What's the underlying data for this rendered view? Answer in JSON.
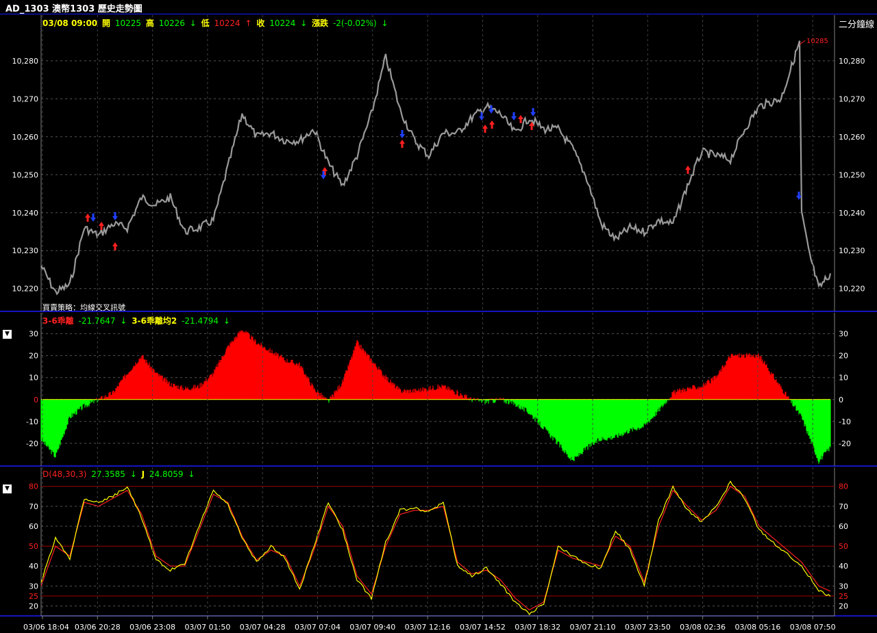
{
  "window": {
    "title": "AD_1303 澳幣1303  歷史走勢圖"
  },
  "price_panel": {
    "readout": {
      "time": "03/08 09:00",
      "open_label": "開",
      "open": "10225",
      "high_label": "高",
      "high": "10226",
      "low_label": "低",
      "low": "10224",
      "close_label": "收",
      "close": "10224",
      "change_label": "漲跌",
      "change": "-2(-0.02%)",
      "arrow_down": "↓",
      "arrow_up": "↑"
    },
    "period_label": "二分鐘線",
    "strategy_label": "買賣策略：均線交叉訊號",
    "last_high_tag": "10285",
    "y_ticks": [
      "10,280",
      "10,270",
      "10,260",
      "10,250",
      "10,240",
      "10,230",
      "10,220"
    ]
  },
  "bias_panel": {
    "readout": {
      "bias_label": "3-6乖離",
      "bias_value": "-21.7647",
      "ma_label": "3-6乖離均2",
      "ma_value": "-21.4794",
      "arrow_down": "↓"
    },
    "y_ticks": [
      "30",
      "20",
      "10",
      "0",
      "-10",
      "-20"
    ],
    "colors": {
      "positive": "#ff0000",
      "negative": "#00ff00"
    }
  },
  "kd_panel": {
    "readout": {
      "d_label": "D(48,30,3)",
      "d_value": "27.3585",
      "j_label": "J",
      "j_value": "24.8059",
      "arrow_down": "↓"
    },
    "y_ticks": [
      "80",
      "70",
      "60",
      "50",
      "40",
      "30",
      "25",
      "20"
    ],
    "colors": {
      "d_line": "#ff2020",
      "j_line": "#ffff00"
    }
  },
  "x_axis": {
    "labels": [
      "03/06 18:04",
      "03/06 20:28",
      "03/06 23:08",
      "03/07 01:50",
      "03/07 04:28",
      "03/07 07:04",
      "03/07 09:40",
      "03/07 12:16",
      "03/07 14:52",
      "03/07 18:32",
      "03/07 21:10",
      "03/07 23:50",
      "03/08 02:36",
      "03/08 05:16",
      "03/08 07:50"
    ]
  },
  "chart_data": [
    {
      "type": "line",
      "name_on_chart": "二分鐘線",
      "ylim": [
        10214,
        10287
      ],
      "x_index": [
        0,
        2,
        4,
        6,
        8,
        10,
        12,
        14,
        16,
        18,
        20,
        22,
        24,
        26,
        28,
        30,
        32,
        34,
        36,
        38,
        40,
        42,
        44,
        46,
        48,
        50,
        52,
        54,
        56,
        58,
        60,
        62,
        64,
        66,
        68,
        70,
        72,
        74,
        76,
        78,
        80,
        82,
        84,
        86,
        88,
        90,
        92,
        94,
        96,
        98,
        100
      ],
      "values": [
        10226,
        10219,
        10221,
        10236,
        10234,
        10237,
        10236,
        10244,
        10242,
        10244,
        10235,
        10236,
        10238,
        10252,
        10266,
        10260,
        10261,
        10259,
        10259,
        10262,
        10253,
        10247,
        10255,
        10266,
        10281,
        10267,
        10259,
        10255,
        10261,
        10261,
        10265,
        10268,
        10266,
        10261,
        10265,
        10262,
        10262,
        10257,
        10249,
        10237,
        10233,
        10236,
        10235,
        10238,
        10237,
        10247,
        10256,
        10255,
        10254,
        10262,
        10268
      ],
      "tail_values": [
        10270,
        10285,
        10240,
        10230,
        10220,
        10224
      ]
    },
    {
      "type": "area",
      "ylim": [
        -30,
        33
      ],
      "ticks": [
        30,
        20,
        10,
        0,
        -10,
        -20
      ],
      "x_index": [
        0,
        2,
        4,
        6,
        8,
        10,
        12,
        14,
        16,
        18,
        20,
        22,
        24,
        26,
        28,
        30,
        32,
        34,
        36,
        38,
        40,
        42,
        44,
        46,
        48,
        50,
        52,
        54,
        56,
        58,
        60,
        62,
        64,
        66,
        68,
        70,
        72,
        74,
        76,
        78,
        80,
        82,
        84,
        86,
        88,
        90,
        92,
        94,
        96,
        98,
        100
      ],
      "values": [
        -18,
        -26,
        -8,
        -3,
        0,
        3,
        12,
        20,
        12,
        7,
        5,
        6,
        12,
        24,
        32,
        26,
        22,
        18,
        16,
        5,
        -1,
        8,
        26,
        18,
        10,
        4,
        4,
        5,
        6,
        3,
        0,
        -1,
        0,
        -2,
        -6,
        -13,
        -20,
        -28,
        -22,
        -18,
        -17,
        -14,
        -12,
        -5,
        3,
        5,
        6,
        10,
        20,
        20,
        20
      ],
      "tail_values": [
        -8,
        -28,
        -21.76
      ]
    },
    {
      "type": "line",
      "ylim": [
        15,
        83
      ],
      "ticks": [
        80,
        70,
        60,
        50,
        40,
        30,
        25,
        20
      ],
      "reference_lines": [
        80,
        50,
        25
      ],
      "series": [
        {
          "name": "D(48,30,3)",
          "x_index": [
            0,
            2,
            4,
            6,
            8,
            10,
            12,
            14,
            16,
            18,
            20,
            22,
            24,
            26,
            28,
            30,
            32,
            34,
            36,
            38,
            40,
            42,
            44,
            46,
            48,
            50,
            52,
            54,
            56,
            58,
            60,
            62,
            64,
            66,
            68,
            70,
            72,
            74,
            76,
            78,
            80,
            82,
            84,
            86,
            88,
            90,
            92,
            94,
            96,
            98,
            100
          ],
          "values": [
            30,
            50,
            45,
            72,
            70,
            74,
            78,
            66,
            45,
            40,
            40,
            58,
            76,
            72,
            55,
            43,
            48,
            45,
            30,
            48,
            70,
            60,
            35,
            26,
            50,
            66,
            68,
            68,
            70,
            42,
            36,
            38,
            33,
            24,
            18,
            22,
            48,
            44,
            42,
            40,
            55,
            50,
            32,
            60,
            78,
            70,
            63,
            68,
            80,
            75,
            60
          ],
          "tail_values": [
            42,
            30,
            27.36
          ]
        },
        {
          "name": "J",
          "x_index": [
            0,
            2,
            4,
            6,
            8,
            10,
            12,
            14,
            16,
            18,
            20,
            22,
            24,
            26,
            28,
            30,
            32,
            34,
            36,
            38,
            40,
            42,
            44,
            46,
            48,
            50,
            52,
            54,
            56,
            58,
            60,
            62,
            64,
            66,
            68,
            70,
            72,
            74,
            76,
            78,
            80,
            82,
            84,
            86,
            88,
            90,
            92,
            94,
            96,
            98,
            100
          ],
          "values": [
            32,
            54,
            44,
            74,
            72,
            75,
            80,
            64,
            43,
            38,
            41,
            60,
            78,
            71,
            54,
            42,
            50,
            44,
            28,
            50,
            72,
            58,
            33,
            24,
            52,
            68,
            69,
            67,
            72,
            40,
            35,
            39,
            31,
            22,
            16,
            21,
            50,
            45,
            41,
            39,
            58,
            48,
            30,
            63,
            80,
            68,
            62,
            70,
            82,
            74,
            58
          ],
          "tail_values": [
            40,
            28,
            24.81
          ]
        }
      ]
    }
  ]
}
